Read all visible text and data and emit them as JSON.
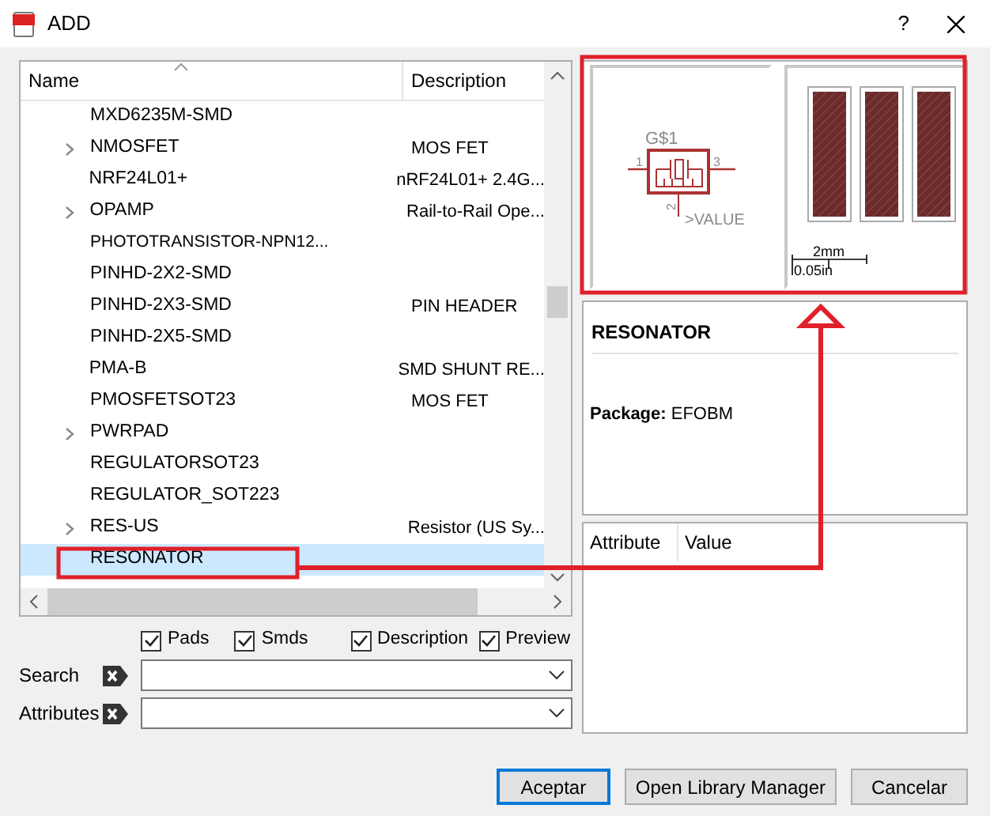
{
  "window": {
    "title": "ADD",
    "help": "?"
  },
  "tree": {
    "columns": [
      "Name",
      "Description"
    ],
    "rows": [
      {
        "name": "MXD6235M-SMD",
        "description": "",
        "expandable": false,
        "selected": false
      },
      {
        "name": "NMOSFET",
        "description": "MOS FET",
        "expandable": true,
        "selected": false
      },
      {
        "name": "NRF24L01+",
        "description": "nRF24L01+ 2.4G...",
        "expandable": false,
        "selected": false
      },
      {
        "name": "OPAMP",
        "description": "Rail-to-Rail Ope...",
        "expandable": true,
        "selected": false
      },
      {
        "name": "PHOTOTRANSISTOR-NPN12...",
        "description": "",
        "expandable": false,
        "selected": false
      },
      {
        "name": "PINHD-2X2-SMD",
        "description": "",
        "expandable": false,
        "selected": false
      },
      {
        "name": "PINHD-2X3-SMD",
        "description": "PIN HEADER",
        "expandable": false,
        "selected": false
      },
      {
        "name": "PINHD-2X5-SMD",
        "description": "",
        "expandable": false,
        "selected": false
      },
      {
        "name": "PMA-B",
        "description": "SMD SHUNT RE...",
        "expandable": false,
        "selected": false
      },
      {
        "name": "PMOSFETSOT23",
        "description": "MOS FET",
        "expandable": false,
        "selected": false
      },
      {
        "name": "PWRPAD",
        "description": "",
        "expandable": true,
        "selected": false
      },
      {
        "name": "REGULATORSOT23",
        "description": "",
        "expandable": false,
        "selected": false
      },
      {
        "name": "REGULATOR_SOT223",
        "description": "",
        "expandable": false,
        "selected": false
      },
      {
        "name": "RES-US",
        "description": "Resistor (US Sy...",
        "expandable": true,
        "selected": false
      },
      {
        "name": "RESONATOR",
        "description": "",
        "expandable": false,
        "selected": true
      }
    ]
  },
  "options": [
    {
      "label": "Pads",
      "checked": true
    },
    {
      "label": "Smds",
      "checked": true
    },
    {
      "label": "Description",
      "checked": true
    },
    {
      "label": "Preview",
      "checked": true
    }
  ],
  "filters": [
    {
      "label": "Search"
    },
    {
      "label": "Attributes"
    }
  ],
  "preview": {
    "symbol": {
      "name": "G$1",
      "pins": [
        "1",
        "3",
        "2"
      ],
      "value": ">VALUE"
    },
    "package": {
      "scale_metric": "2mm",
      "scale_imperial": "0.05in"
    }
  },
  "details": {
    "title": "RESONATOR",
    "package": "**Package:** EFOBM"
  },
  "attributes": {
    "columns": [
      "Attribute",
      "Value"
    ]
  },
  "buttons": [
    {
      "label": "Aceptar",
      "default": true
    },
    {
      "label": "Open Library Manager",
      "default": false
    },
    {
      "label": "Cancelar",
      "default": false
    }
  ]
}
